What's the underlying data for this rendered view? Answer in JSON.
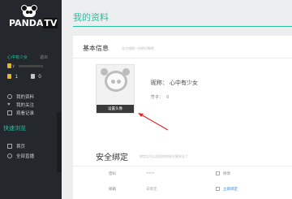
{
  "sidebar": {
    "logo_text": "PANDA",
    "logo_tv": "TV",
    "user_name": "心中有少女",
    "user_level": "退出",
    "level_label": "y",
    "coin_count": "1",
    "bamboo_count": "0",
    "menu": [
      {
        "label": "我的资料",
        "icon": "user-icon"
      },
      {
        "label": "我的关注",
        "icon": "heart-icon"
      },
      {
        "label": "观看记录",
        "icon": "history-icon"
      }
    ],
    "quick_title": "快速浏览",
    "quick_menu": [
      {
        "label": "首页",
        "icon": "home-icon"
      },
      {
        "label": "全部直播",
        "icon": "globe-icon"
      }
    ]
  },
  "main": {
    "page_title": "我的资料",
    "basic": {
      "title": "基本信息",
      "hint": "花点钱换一份的印象吧",
      "avatar_button": "设置头像",
      "nickname_label": "昵称：",
      "nickname_value": "心中有少女",
      "bamboo_label": "竹子：",
      "bamboo_value": "0"
    },
    "security": {
      "title": "安全绑定",
      "hint": "绑定后可以找回你的账号更安全了",
      "rows": [
        {
          "label": "密码",
          "value": "******",
          "action": "修改",
          "action_link": false
        },
        {
          "label": "邮箱",
          "value": "未绑定",
          "action": "立即绑定",
          "action_link": true
        }
      ]
    }
  },
  "colors": {
    "accent": "#27c1a0",
    "sidebar_bg": "#24272b",
    "alert_red": "#e04b4b"
  }
}
